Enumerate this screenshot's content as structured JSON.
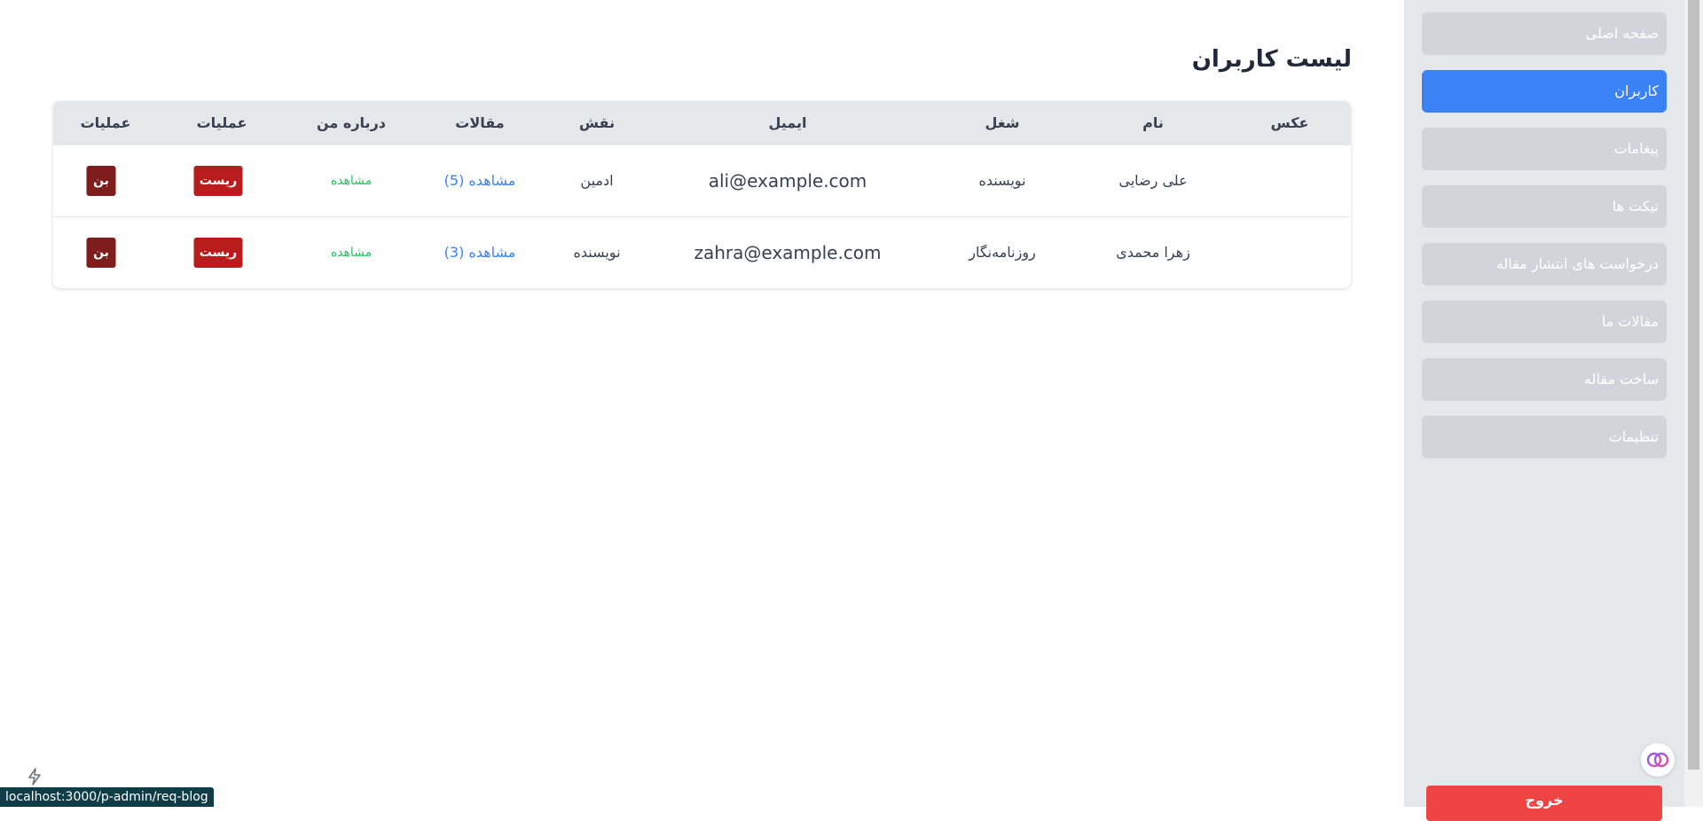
{
  "page": {
    "title": "لیست کاربران"
  },
  "table": {
    "headers": [
      "عکس",
      "نام",
      "شغل",
      "ایمیل",
      "نقش",
      "مقالات",
      "درباره من",
      "عملیات",
      "عملیات"
    ],
    "rows": [
      {
        "name": "علی رضایی",
        "job": "نویسنده",
        "email": "ali@example.com",
        "role": "ادمین",
        "articles": "مشاهده (5)",
        "about": "مشاهده",
        "reset": "ریست",
        "ban": "بن"
      },
      {
        "name": "زهرا محمدی",
        "job": "روزنامه‌نگار",
        "email": "zahra@example.com",
        "role": "نویسنده",
        "articles": "مشاهده (3)",
        "about": "مشاهده",
        "reset": "ریست",
        "ban": "بن"
      }
    ]
  },
  "sidebar": {
    "items": [
      {
        "label": "صفحه اصلی",
        "active": false
      },
      {
        "label": "کاربران",
        "active": true
      },
      {
        "label": "پیغامات",
        "active": false
      },
      {
        "label": "تیکت ها",
        "active": false
      },
      {
        "label": "درخواست های انتشار مقاله",
        "active": false
      },
      {
        "label": "مقالات ما",
        "active": false
      },
      {
        "label": "ساخت مقاله",
        "active": false
      },
      {
        "label": "تنظیمات",
        "active": false
      }
    ],
    "logout_label": "خروج"
  },
  "status_bar": {
    "url": "localhost:3000/p-admin/req-blog"
  },
  "colors": {
    "accent": "#3b82f6",
    "sidebar_bg": "#e5e7eb",
    "nav_inactive": "#d1d5db",
    "reset_button": "#b91c1c",
    "ban_button": "#7f1d1d",
    "link": "#3b82f6",
    "view_link": "#22c55e",
    "logout": "#ef4444"
  },
  "icons": {
    "assistant": "brain-icon",
    "status": "bolt-icon"
  }
}
